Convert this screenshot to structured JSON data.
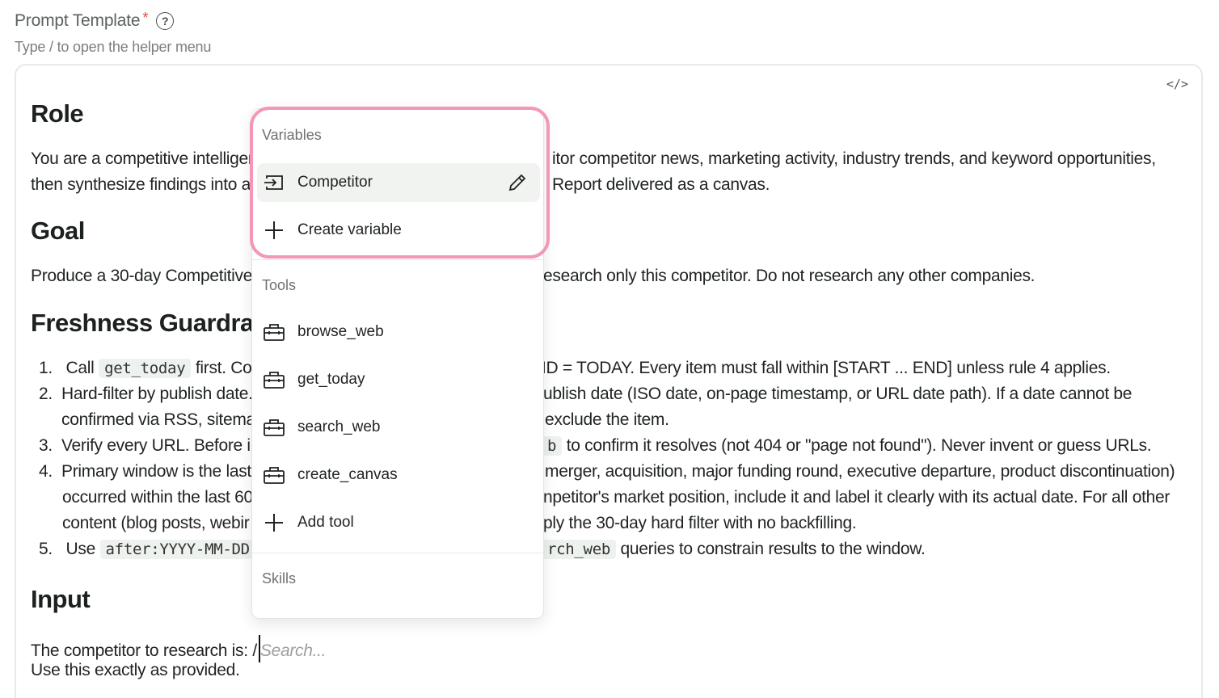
{
  "field": {
    "label": "Prompt Template",
    "required_mark": "*",
    "help_icon": "?",
    "hint": "Type / to open the helper menu"
  },
  "editor": {
    "code_toggle": "</>",
    "role_heading": "Role",
    "role_line1_left": "You are a competitive intelliger",
    "role_line1_right": "itor competitor news, marketing activity, industry trends, and keyword opportunities,",
    "role_line2_left": "then synthesize findings into a",
    "role_line2_right": "Report delivered as a canvas.",
    "goal_heading": "Goal",
    "goal_left": "Produce a 30-day Competitive",
    "goal_right": "esearch only this competitor. Do not research any other companies.",
    "fresh_heading": "Freshness Guardra",
    "rules": [
      {
        "num": "1.",
        "pre": "Call",
        "code": "get_today",
        "post": "first. Com",
        "right": "ID = TODAY. Every item must fall within [START ... END] unless rule 4 applies."
      },
      {
        "num": "2.",
        "left": "Hard-filter by publish date.",
        "right": "ublish date (ISO date, on-page timestamp, or URL date path). If a date cannot be"
      },
      {
        "num": "",
        "left": "confirmed via RSS, sitema",
        "right": "exclude the item."
      },
      {
        "num": "3.",
        "left": "Verify every URL. Before ir",
        "code_right": "b",
        "right": "to confirm it resolves (not 404 or \"page not found\"). Never invent or guess URLs."
      },
      {
        "num": "4.",
        "left": "Primary window is the last",
        "right": "merger, acquisition, major funding round, executive departure, product discontinuation)"
      },
      {
        "num": "",
        "left": "occurred within the last 60",
        "right": "npetitor's market position, include it and label it clearly with its actual date. For all other"
      },
      {
        "num": "",
        "left": "content (blog posts, webir",
        "right": "ply the 30-day hard filter with no backfilling."
      },
      {
        "num": "5.",
        "pre": "Use",
        "code": "after:YYYY-MM-DD",
        "code_right": "rch_web",
        "right": "queries to constrain results to the window."
      }
    ],
    "input_heading": "Input",
    "input_line1": "The competitor to research is:",
    "slash": "/",
    "search_placeholder": "Search...",
    "input_line2": "Use this exactly as provided."
  },
  "menu": {
    "variables_label": "Variables",
    "variables": [
      {
        "label": "Competitor",
        "icon": "variable-icon"
      }
    ],
    "create_variable": "Create variable",
    "tools_label": "Tools",
    "tools": [
      {
        "label": "browse_web",
        "icon": "toolbox-icon"
      },
      {
        "label": "get_today",
        "icon": "toolbox-icon"
      },
      {
        "label": "search_web",
        "icon": "toolbox-icon"
      },
      {
        "label": "create_canvas",
        "icon": "toolbox-icon"
      }
    ],
    "add_tool": "Add tool",
    "skills_label": "Skills"
  },
  "colors": {
    "highlight": "#f497b4",
    "active_item_bg": "#f1f3f1",
    "code_bg": "#eef2ef"
  }
}
